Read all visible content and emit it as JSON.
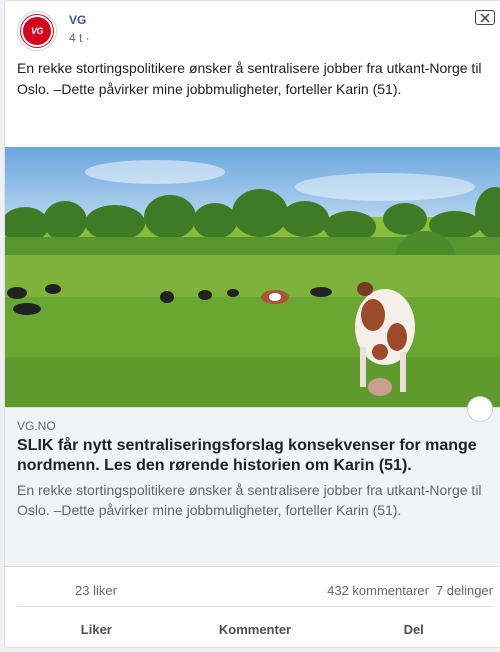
{
  "post": {
    "page_name": "VG",
    "avatar_text": "VG",
    "timestamp": "4 t ·",
    "text": "En rekke stortingspolitikere ønsker å sentralisere jobber fra utkant-Norge til Oslo. –Dette påvirker mine jobbmuligheter, forteller Karin (51)."
  },
  "link": {
    "domain": "VG.NO",
    "title": "SLIK får nytt sentraliseringsforslag konsekvenser for mange nordmenn. Les den rørende historien om Karin (51).",
    "description": "En rekke stortingspolitikere ønsker å sentralisere jobber fra utkant-Norge til Oslo. –Dette påvirker mine jobbmuligheter, forteller Karin (51).",
    "image": "cows-grazing-photo"
  },
  "stats": {
    "likes": "23 liker",
    "comments": "432 kommentarer",
    "shares": "7 delinger"
  },
  "actions": {
    "like": "Liker",
    "comment": "Kommenter",
    "share": "Del"
  },
  "colors": {
    "brand_red": "#d5001c",
    "link_blue": "#385898",
    "muted": "#606770"
  }
}
